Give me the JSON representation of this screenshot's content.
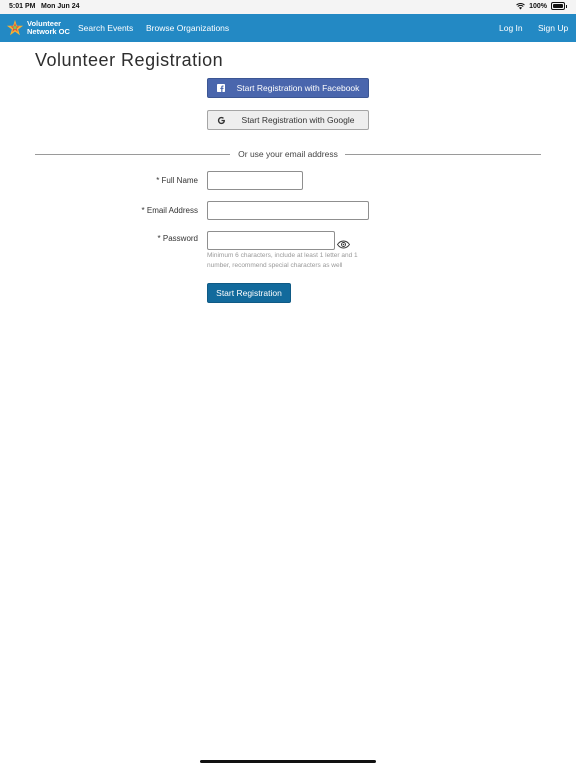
{
  "status_bar": {
    "time": "5:01 PM",
    "date": "Mon Jun 24",
    "battery": "100%"
  },
  "nav": {
    "logo_line1": "Volunteer",
    "logo_line2": "Network OC",
    "search_events": "Search Events",
    "browse_orgs": "Browse Organizations",
    "login": "Log In",
    "signup": "Sign Up",
    "background": "#2389c4"
  },
  "page": {
    "title": "Volunteer Registration"
  },
  "social": {
    "facebook_label": "Start Registration with Facebook",
    "google_label": "Start Registration with Google",
    "facebook_color": "#4a66ad"
  },
  "divider": {
    "text": "Or use your email address"
  },
  "form": {
    "required_marker": "*",
    "full_name_label": "Full Name",
    "full_name_value": "",
    "email_label": "Email Address",
    "email_value": "",
    "password_label": "Password",
    "password_value": "",
    "password_hint": "Minimum 6 characters, include at least 1 letter and 1 number, recommend special characters as well",
    "submit_label": "Start Registration",
    "submit_color": "#126a9c"
  },
  "icons": {
    "wifi": "wifi-icon",
    "battery": "battery-icon",
    "logo": "star-logo-icon",
    "facebook": "facebook-icon",
    "google": "google-icon",
    "show_password": "eye-icon"
  }
}
